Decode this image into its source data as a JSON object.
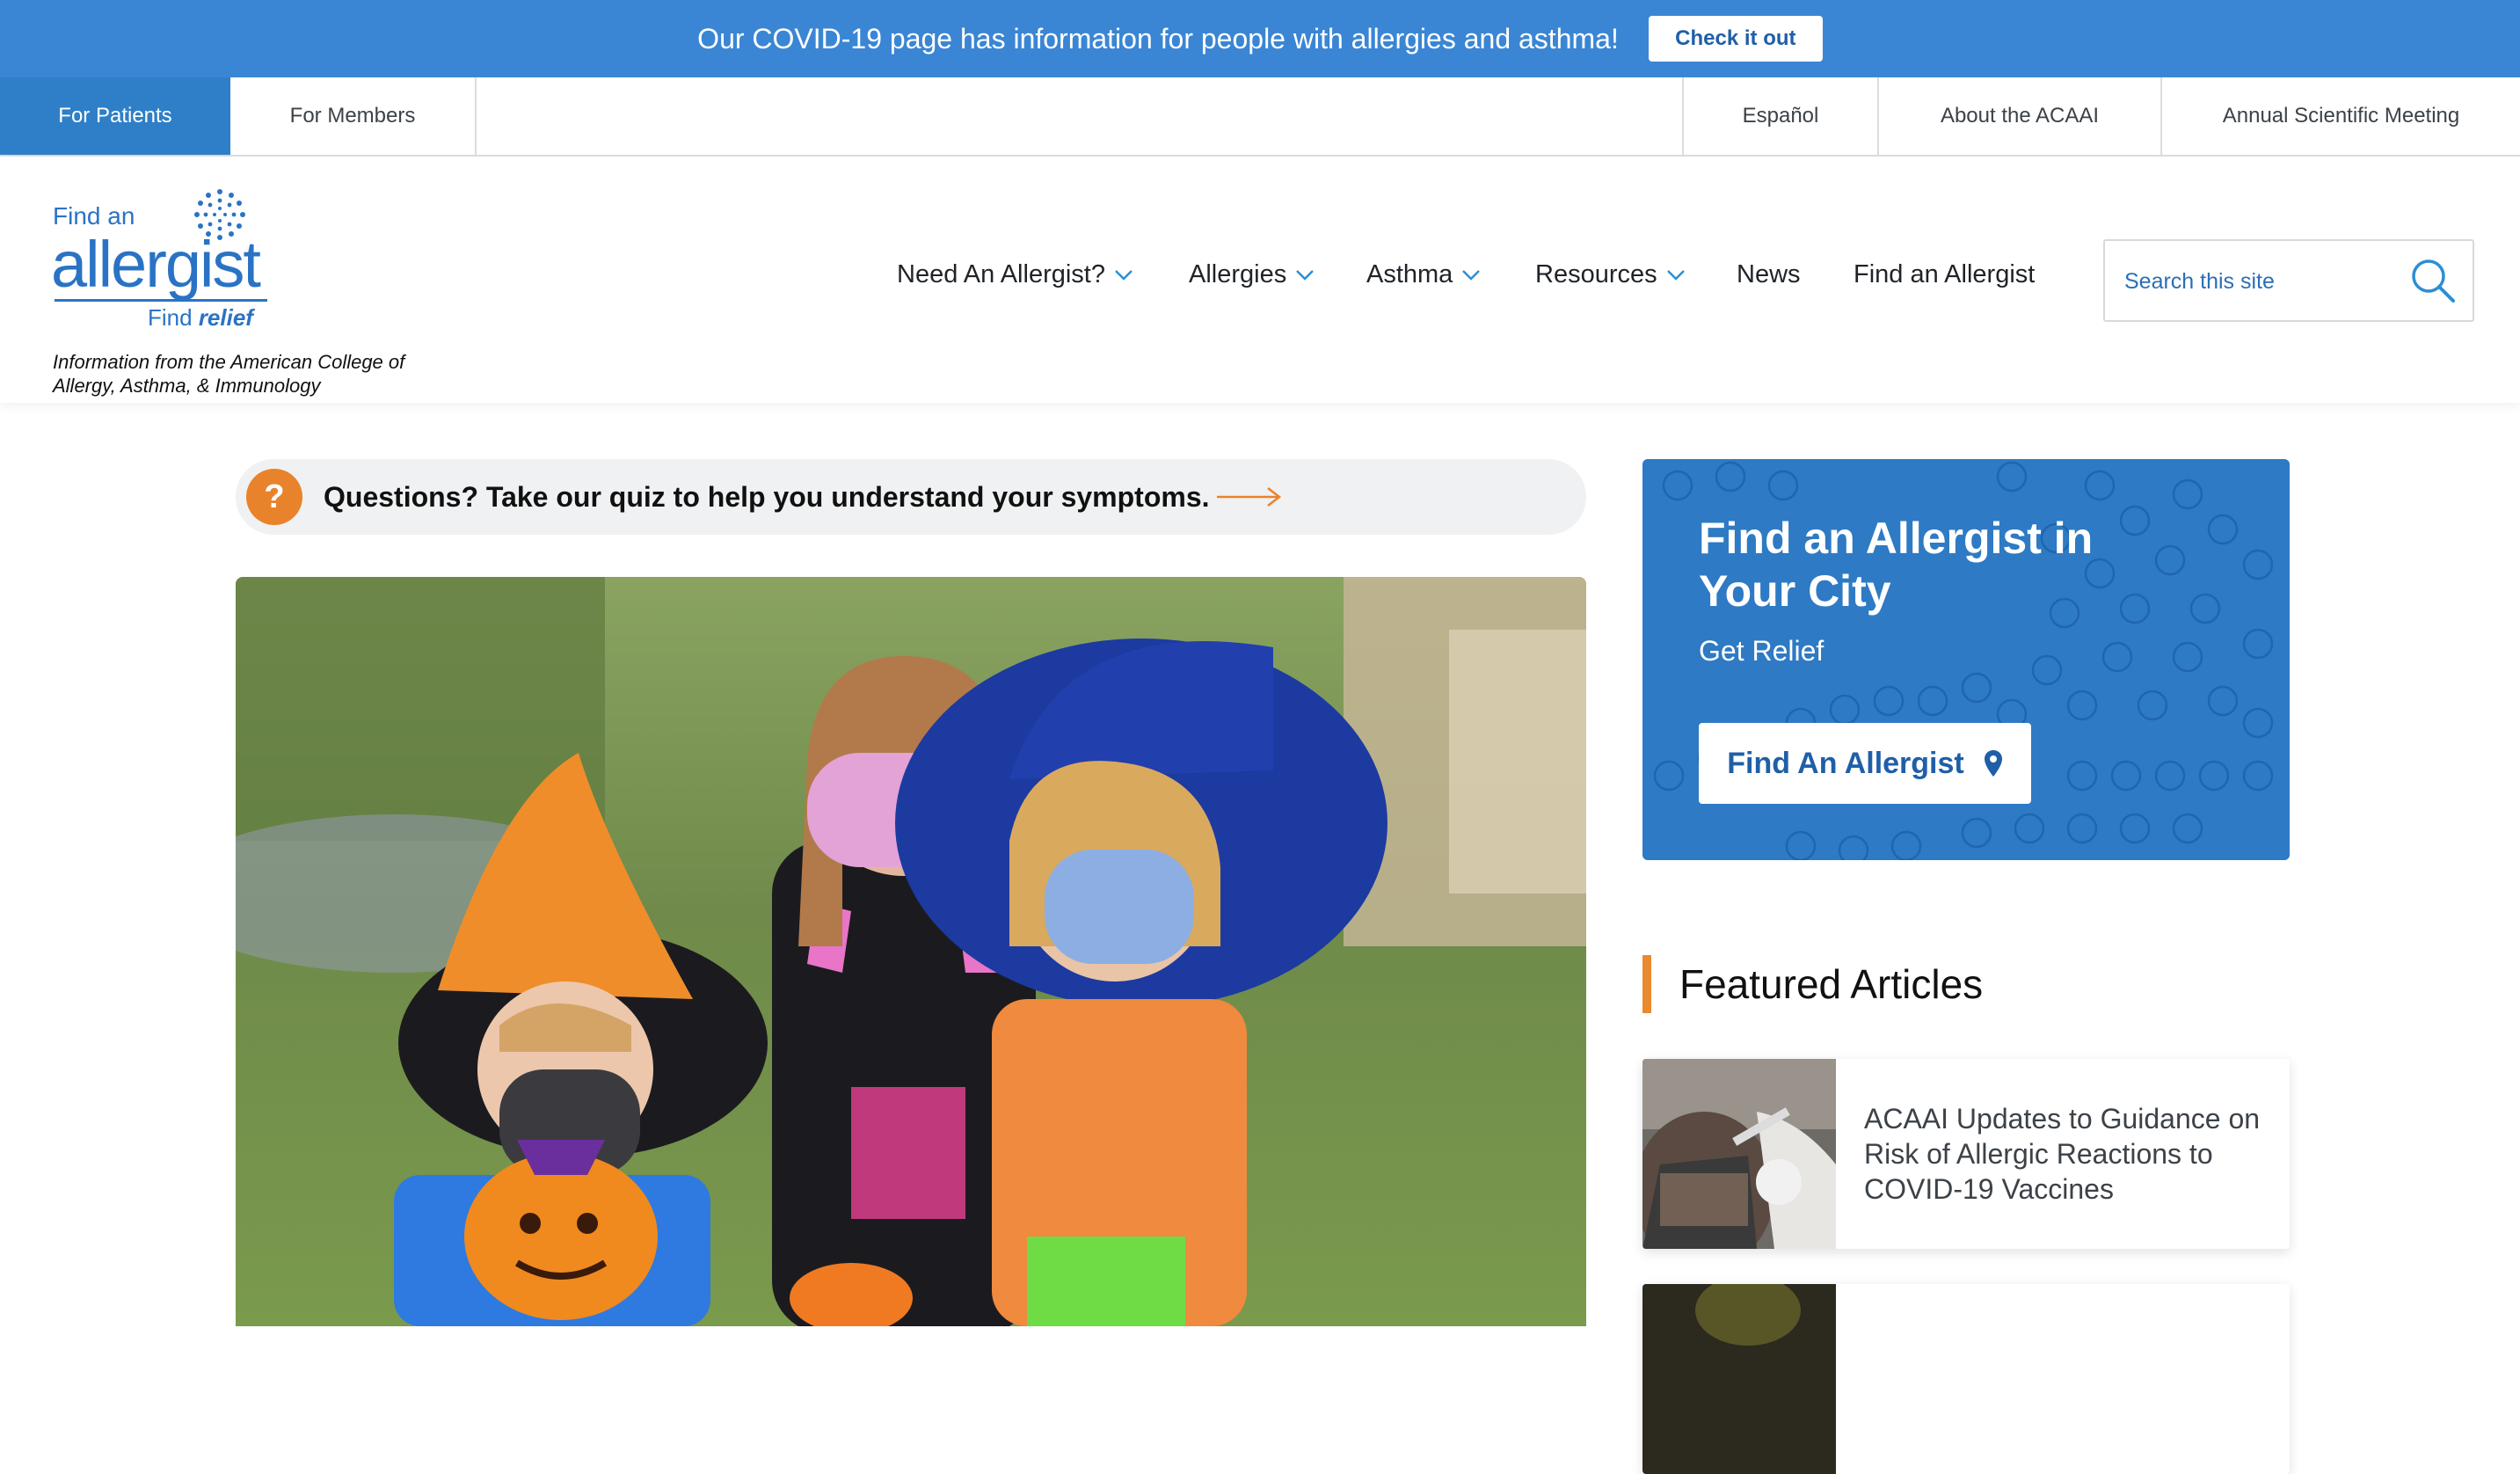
{
  "banner": {
    "message": "Our COVID-19 page has information for people with allergies and asthma!",
    "button_label": "Check it out"
  },
  "utility_nav": {
    "left_tabs": [
      {
        "label": "For Patients",
        "active": true
      },
      {
        "label": "For Members",
        "active": false
      }
    ],
    "right_tabs": [
      {
        "label": "Español"
      },
      {
        "label": "About the ACAAI"
      },
      {
        "label": "Annual Scientific Meeting"
      }
    ]
  },
  "logo": {
    "find_an": "Find an",
    "allergist": "allergist",
    "find": "Find",
    "relief": "relief",
    "tagline": "Information from the American College of Allergy, Asthma, & Immunology"
  },
  "main_nav": {
    "items": [
      {
        "label": "Need An Allergist?",
        "dropdown": true
      },
      {
        "label": "Allergies",
        "dropdown": true
      },
      {
        "label": "Asthma",
        "dropdown": true
      },
      {
        "label": "Resources",
        "dropdown": true
      },
      {
        "label": "News",
        "dropdown": false
      },
      {
        "label": "Find an Allergist",
        "dropdown": false
      }
    ]
  },
  "search": {
    "placeholder": "Search this site",
    "icon": "search-icon"
  },
  "quiz": {
    "badge": "?",
    "text": "Questions? Take our quiz to help you understand your symptoms."
  },
  "hero": {
    "image_subject": "children-in-halloween-costumes-wearing-masks"
  },
  "find_card": {
    "title": "Find an Allergist in Your City",
    "subtitle": "Get Relief",
    "button_label": "Find An Allergist",
    "button_icon": "map-pin-icon"
  },
  "featured": {
    "heading": "Featured Articles",
    "articles": [
      {
        "title": "ACAAI Updates to Guidance on Risk of Allergic Reactions to COVID-19 Vaccines"
      },
      {
        "title": ""
      }
    ]
  },
  "colors": {
    "banner_blue": "#3a86d4",
    "brand_blue": "#2a73c4",
    "card_blue": "#2e7ac4",
    "accent_orange": "#e9832b"
  }
}
